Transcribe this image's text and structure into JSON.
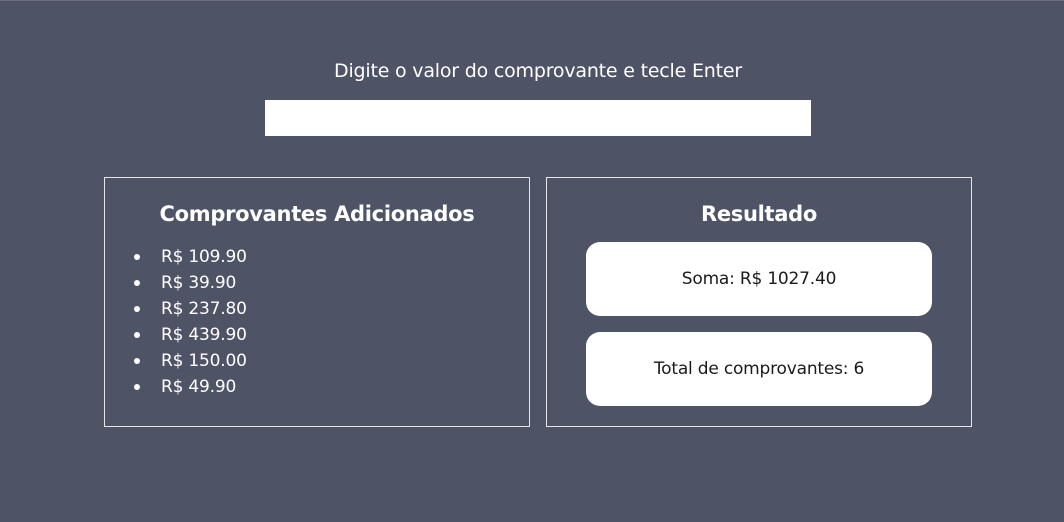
{
  "header": {
    "prompt": "Digite o valor do comprovante e tecle Enter"
  },
  "input": {
    "value": "",
    "placeholder": ""
  },
  "receipts_panel": {
    "title": "Comprovantes Adicionados",
    "items": [
      "R$ 109.90",
      "R$ 39.90",
      "R$ 237.80",
      "R$ 439.90",
      "R$ 150.00",
      "R$ 49.90"
    ]
  },
  "result_panel": {
    "title": "Resultado",
    "sum": "Soma: R$ 1027.40",
    "count": "Total de comprovantes: 6"
  },
  "colors": {
    "background": "#4f5366",
    "panel_border": "#e6e7ec",
    "card_background": "#ffffff"
  }
}
